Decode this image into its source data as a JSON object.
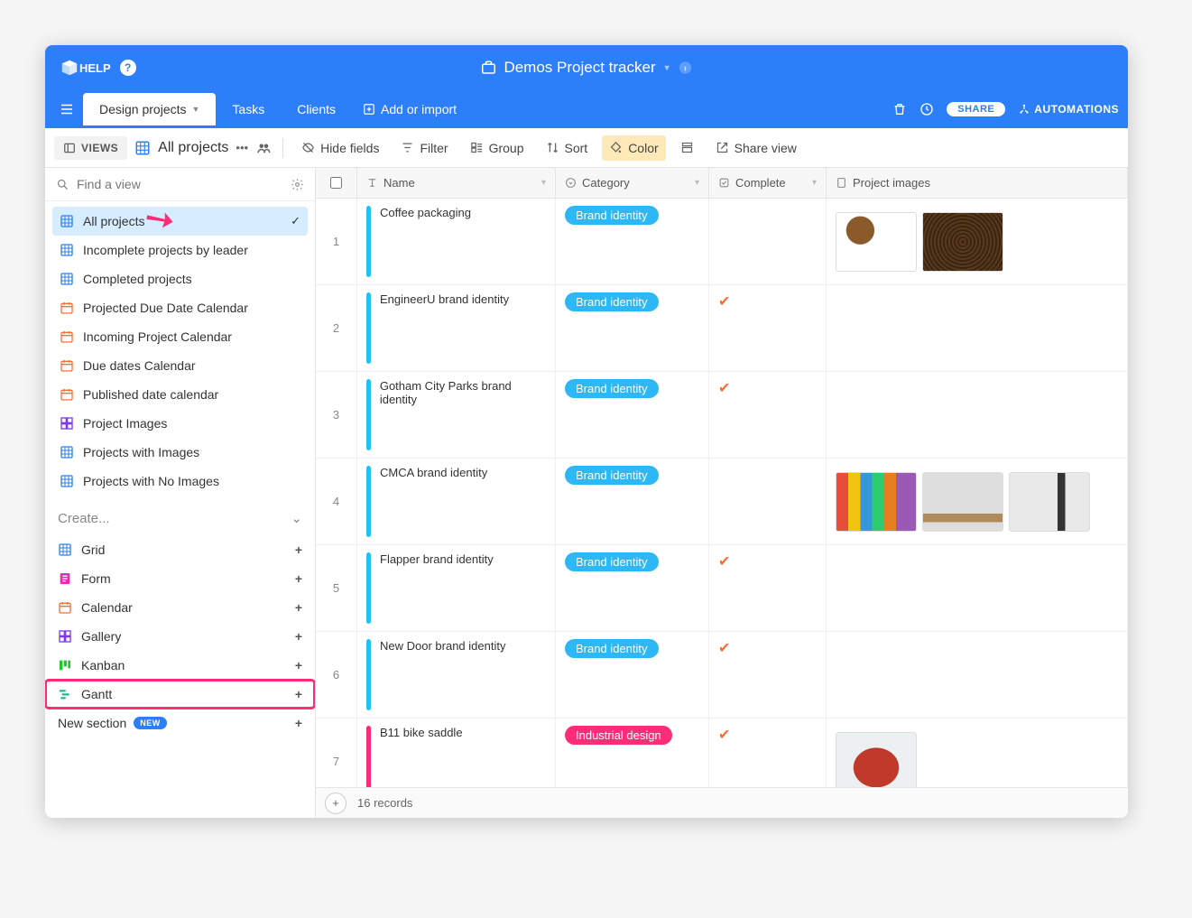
{
  "header": {
    "workspace_title": "Demos Project tracker",
    "help_label": "HELP"
  },
  "tabs": {
    "items": [
      "Design projects",
      "Tasks",
      "Clients"
    ],
    "active_index": 0,
    "add_import_label": "Add or import",
    "share_label": "SHARE",
    "automations_label": "AUTOMATIONS"
  },
  "toolbar": {
    "views_toggle": "VIEWS",
    "current_view": "All projects",
    "hide_fields": "Hide fields",
    "filter": "Filter",
    "group": "Group",
    "sort": "Sort",
    "color": "Color",
    "share_view": "Share view"
  },
  "sidebar": {
    "search_placeholder": "Find a view",
    "views": [
      {
        "name": "All projects",
        "type": "grid",
        "selected": true
      },
      {
        "name": "Incomplete projects by leader",
        "type": "grid"
      },
      {
        "name": "Completed projects",
        "type": "grid"
      },
      {
        "name": "Projected Due Date Calendar",
        "type": "calendar"
      },
      {
        "name": "Incoming Project Calendar",
        "type": "calendar"
      },
      {
        "name": "Due dates Calendar",
        "type": "calendar"
      },
      {
        "name": "Published date calendar",
        "type": "calendar"
      },
      {
        "name": "Project Images",
        "type": "gallery"
      },
      {
        "name": "Projects with Images",
        "type": "grid"
      },
      {
        "name": "Projects with No Images",
        "type": "grid"
      }
    ],
    "create_label": "Create...",
    "create_types": [
      {
        "name": "Grid",
        "type": "grid"
      },
      {
        "name": "Form",
        "type": "form"
      },
      {
        "name": "Calendar",
        "type": "calendar"
      },
      {
        "name": "Gallery",
        "type": "gallery"
      },
      {
        "name": "Kanban",
        "type": "kanban"
      },
      {
        "name": "Gantt",
        "type": "gantt",
        "highlighted": true
      }
    ],
    "new_section_label": "New section",
    "new_badge": "NEW"
  },
  "grid": {
    "columns": [
      "Name",
      "Category",
      "Complete",
      "Project images"
    ],
    "rows": [
      {
        "num": 1,
        "name": "Coffee packaging",
        "category": "Brand identity",
        "cat_color": "#2db7f5",
        "bar_color": "#20c3f3",
        "complete": false,
        "images": [
          "coffee1",
          "coffee2"
        ]
      },
      {
        "num": 2,
        "name": "EngineerU brand identity",
        "category": "Brand identity",
        "cat_color": "#2db7f5",
        "bar_color": "#20c3f3",
        "complete": true,
        "images": []
      },
      {
        "num": 3,
        "name": "Gotham City Parks brand identity",
        "category": "Brand identity",
        "cat_color": "#2db7f5",
        "bar_color": "#20c3f3",
        "complete": true,
        "images": []
      },
      {
        "num": 4,
        "name": "CMCA brand identity",
        "category": "Brand identity",
        "cat_color": "#2db7f5",
        "bar_color": "#20c3f3",
        "complete": false,
        "images": [
          "museum1",
          "museum2",
          "museum3"
        ]
      },
      {
        "num": 5,
        "name": "Flapper brand identity",
        "category": "Brand identity",
        "cat_color": "#2db7f5",
        "bar_color": "#20c3f3",
        "complete": true,
        "images": []
      },
      {
        "num": 6,
        "name": "New Door brand identity",
        "category": "Brand identity",
        "cat_color": "#2db7f5",
        "bar_color": "#20c3f3",
        "complete": true,
        "images": []
      },
      {
        "num": 7,
        "name": "B11 bike saddle",
        "category": "Industrial design",
        "cat_color": "#ff2d78",
        "bar_color": "#ff2d78",
        "complete": true,
        "images": [
          "saddle"
        ]
      }
    ],
    "record_count": "16 records"
  },
  "colors": {
    "icon_grid": "#2d7ff9",
    "icon_calendar": "#ff6f2c",
    "icon_gallery": "#7c39ed",
    "icon_form": "#e929ba",
    "icon_kanban": "#20c933",
    "icon_gantt": "#11af82"
  }
}
